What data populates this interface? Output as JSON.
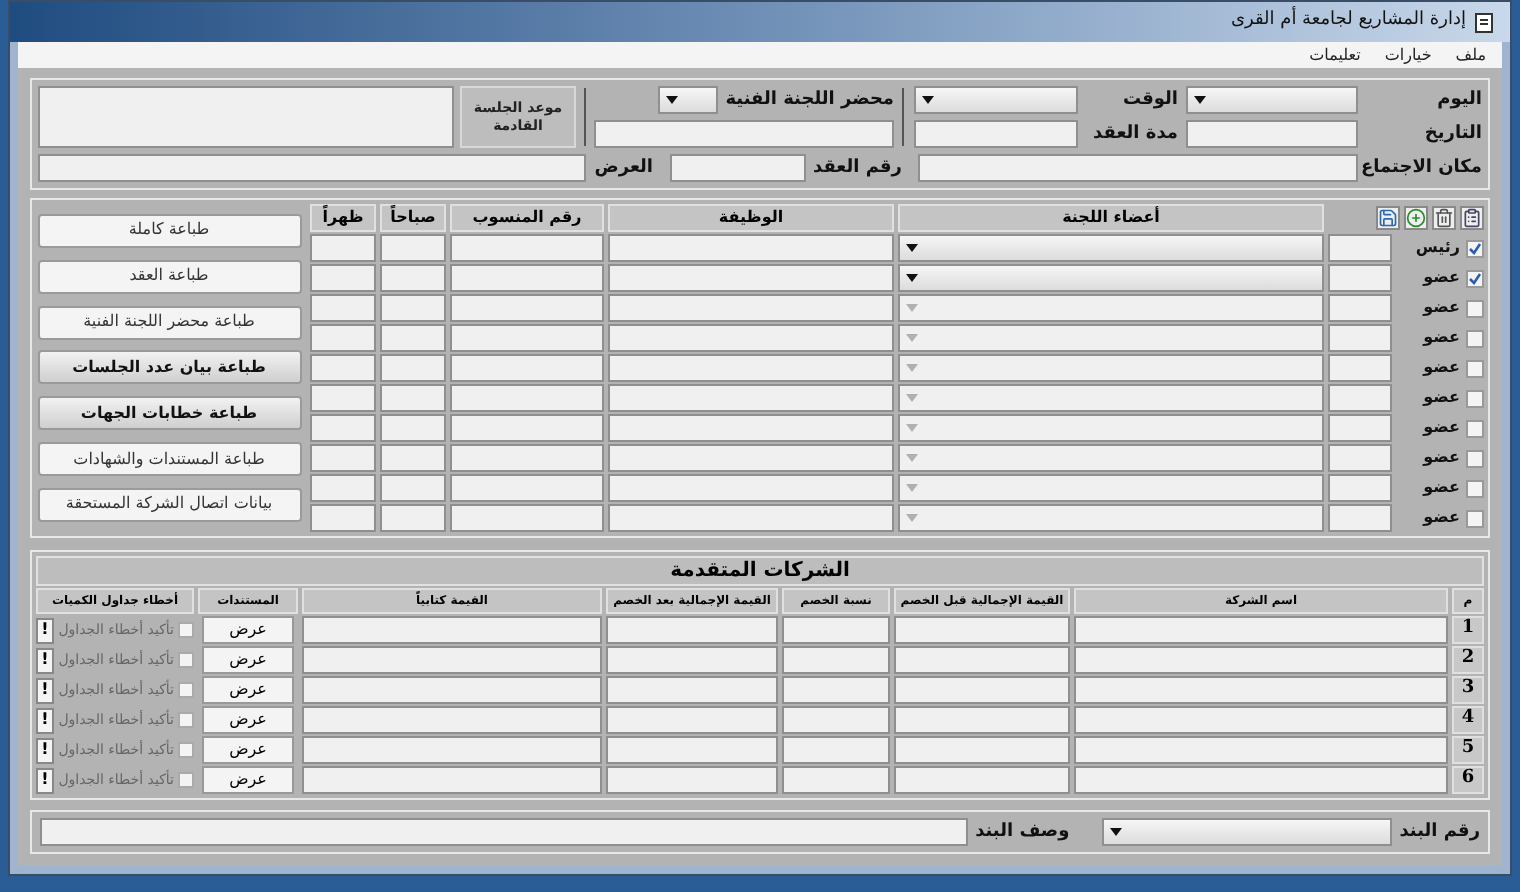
{
  "window": {
    "title": "إدارة المشاريع لجامعة أم القرى"
  },
  "menu": [
    {
      "label": "ملف"
    },
    {
      "label": "خيارات"
    },
    {
      "label": "تعليمات"
    }
  ],
  "meeting": {
    "day_label": "اليوم",
    "time_label": "الوقت",
    "date_label": "التاريخ",
    "duration_label": "مدة العقد",
    "place_label": "مكان الاجتماع",
    "report_label": "محضر اللجنة الفنية",
    "contract_no_label": "رقم العقد",
    "next_session_label": "موعد الجلسة القادمة",
    "offer_label": "العرض"
  },
  "members": {
    "columns": [
      "أعضاء اللجنة",
      "الوظيفة",
      "رقم المنسوب",
      "صباحاً",
      "ظهراً"
    ],
    "rows": [
      {
        "role": "رئيس",
        "checked": true,
        "disabled": false
      },
      {
        "role": "عضو",
        "checked": true,
        "disabled": false
      },
      {
        "role": "عضو",
        "checked": false,
        "disabled": true
      },
      {
        "role": "عضو",
        "checked": false,
        "disabled": true
      },
      {
        "role": "عضو",
        "checked": false,
        "disabled": true
      },
      {
        "role": "عضو",
        "checked": false,
        "disabled": true
      },
      {
        "role": "عضو",
        "checked": false,
        "disabled": true
      },
      {
        "role": "عضو",
        "checked": false,
        "disabled": true
      },
      {
        "role": "عضو",
        "checked": false,
        "disabled": true
      },
      {
        "role": "عضو",
        "checked": false,
        "disabled": true
      }
    ]
  },
  "print_buttons": [
    {
      "label": "طباعة كاملة",
      "bold": false
    },
    {
      "label": "طباعة العقد",
      "bold": false
    },
    {
      "label": "طباعة محضر اللجنة الفنية",
      "bold": false
    },
    {
      "label": "طباعة بيان عدد الجلسات",
      "bold": true
    },
    {
      "label": "طباعة خطابات الجهات",
      "bold": true
    },
    {
      "label": "طباعة المستندات والشهادات",
      "bold": false
    },
    {
      "label": "بيانات اتصال الشركة المستحقة",
      "bold": false
    }
  ],
  "companies": {
    "title": "الشركات المتقدمة",
    "columns": [
      "م",
      "اسم الشركة",
      "القيمة الإجمالية قبل الخصم",
      "نسبة الخصم",
      "القيمة الإجمالية بعد الخصم",
      "القيمة كتابياً",
      "المستندات",
      "أخطاء جداول الكميات"
    ],
    "rows": [
      {
        "number": "1",
        "documents_button": "عرض",
        "confirm_label": "تأكيد أخطاء الجداول",
        "confirmed": false,
        "alert_button": "!"
      },
      {
        "number": "2",
        "documents_button": "عرض",
        "confirm_label": "تأكيد أخطاء الجداول",
        "confirmed": false,
        "alert_button": "!"
      },
      {
        "number": "3",
        "documents_button": "عرض",
        "confirm_label": "تأكيد أخطاء الجداول",
        "confirmed": false,
        "alert_button": "!"
      },
      {
        "number": "4",
        "documents_button": "عرض",
        "confirm_label": "تأكيد أخطاء الجداول",
        "confirmed": false,
        "alert_button": "!"
      },
      {
        "number": "5",
        "documents_button": "عرض",
        "confirm_label": "تأكيد أخطاء الجداول",
        "confirmed": false,
        "alert_button": "!"
      },
      {
        "number": "6",
        "documents_button": "عرض",
        "confirm_label": "تأكيد أخطاء الجداول",
        "confirmed": false,
        "alert_button": "!"
      }
    ]
  },
  "item": {
    "number_label": "رقم البند",
    "description_label": "وصف البند"
  }
}
